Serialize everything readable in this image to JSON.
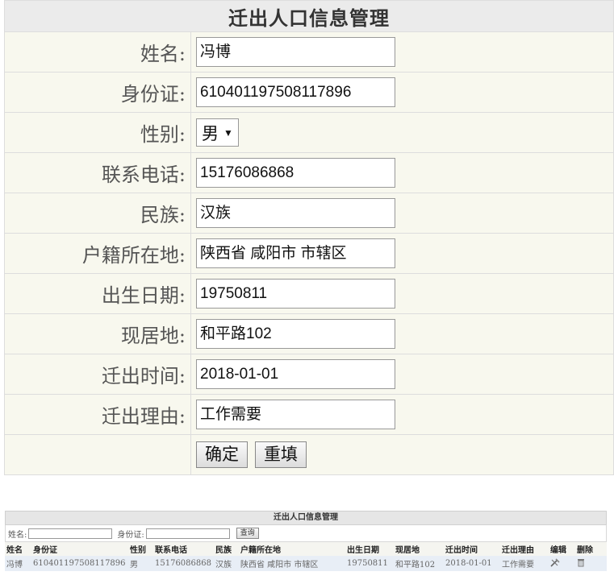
{
  "form": {
    "title": "迁出人口信息管理",
    "fields": [
      {
        "label": "姓名:",
        "value": "冯博"
      },
      {
        "label": "身份证:",
        "value": "610401197508117896"
      },
      {
        "label": "性别:",
        "value": "男"
      },
      {
        "label": "联系电话:",
        "value": "15176086868"
      },
      {
        "label": "民族:",
        "value": "汉族"
      },
      {
        "label": "户籍所在地:",
        "value": "陕西省 咸阳市 市辖区"
      },
      {
        "label": "出生日期:",
        "value": "19750811"
      },
      {
        "label": "现居地:",
        "value": "和平路102"
      },
      {
        "label": "迁出时间:",
        "value": "2018-01-01"
      },
      {
        "label": "迁出理由:",
        "value": "工作需要"
      }
    ],
    "confirm_label": "确定",
    "reset_label": "重填"
  },
  "list": {
    "title": "迁出人口信息管理",
    "search": {
      "name_label": "姓名:",
      "name_value": "",
      "id_label": "身份证:",
      "id_value": "",
      "query_label": "查询"
    },
    "columns": [
      "姓名",
      "身份证",
      "性别",
      "联系电话",
      "民族",
      "户籍所在地",
      "出生日期",
      "现居地",
      "迁出时间",
      "迁出理由",
      "编辑",
      "删除"
    ],
    "rows": [
      {
        "name": "冯博",
        "id": "610401197508117896",
        "gender": "男",
        "phone": "15176086868",
        "ethnicity": "汉族",
        "household": "陕西省 咸阳市 市辖区",
        "birth": "19750811",
        "residence": "和平路102",
        "move_time": "2018-01-01",
        "reason": "工作需要",
        "edit_icon": "edit-icon",
        "delete_icon": "trash-icon"
      }
    ]
  },
  "colors": {
    "form_row_bg": "#f8f8ee",
    "title_bg": "#ebebeb",
    "list_row_bg": "#e8eef6"
  }
}
